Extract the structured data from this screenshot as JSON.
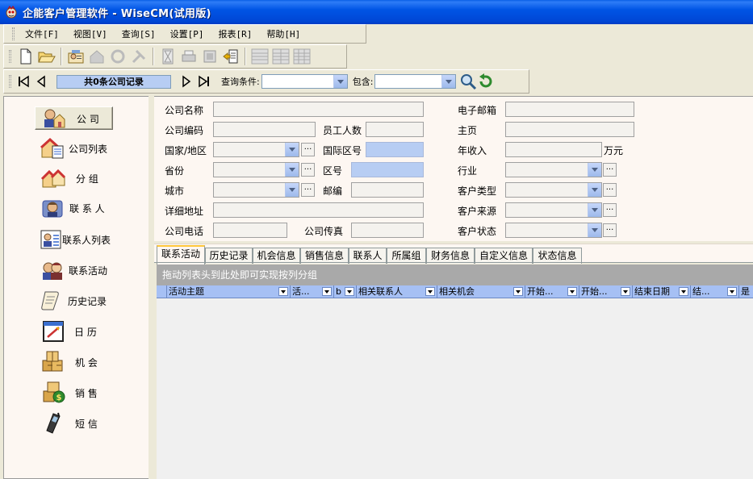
{
  "window": {
    "title": "企能客户管理软件 - WiseCM(试用版)"
  },
  "menu": [
    "文件[F]",
    "视图[V]",
    "查询[S]",
    "设置[P]",
    "报表[R]",
    "帮助[H]"
  ],
  "nav": {
    "record_label": "共0条公司记录",
    "query_label": "查询条件:",
    "contains_label": "包含:",
    "query_value": "",
    "contains_value": ""
  },
  "sidebar": {
    "items": [
      {
        "label": "公  司",
        "icon": "company-icon"
      },
      {
        "label": "公司列表",
        "icon": "company-list-icon"
      },
      {
        "label": "分  组",
        "icon": "group-icon"
      },
      {
        "label": "联 系 人",
        "icon": "contact-icon"
      },
      {
        "label": "联系人列表",
        "icon": "contact-list-icon"
      },
      {
        "label": "联系活动",
        "icon": "activity-icon"
      },
      {
        "label": "历史记录",
        "icon": "history-icon"
      },
      {
        "label": "日  历",
        "icon": "calendar-icon"
      },
      {
        "label": "机  会",
        "icon": "opportunity-icon"
      },
      {
        "label": "销  售",
        "icon": "sales-icon"
      },
      {
        "label": "短  信",
        "icon": "sms-icon"
      }
    ]
  },
  "form": {
    "company_name": "公司名称",
    "email": "电子邮箱",
    "company_code": "公司编码",
    "employees": "员工人数",
    "homepage": "主页",
    "country": "国家/地区",
    "intl_code": "国际区号",
    "annual_income": "年收入",
    "currency_unit": "万元",
    "province": "省份",
    "area_code": "区号",
    "industry": "行业",
    "city": "城市",
    "postcode": "邮编",
    "customer_type": "客户类型",
    "address": "详细地址",
    "customer_source": "客户来源",
    "phone": "公司电话",
    "fax": "公司传真",
    "customer_status": "客户状态"
  },
  "tabs": [
    "联系活动",
    "历史记录",
    "机会信息",
    "销售信息",
    "联系人",
    "所属组",
    "财务信息",
    "自定义信息",
    "状态信息"
  ],
  "grid": {
    "group_hint": "拖动列表头到此处即可实现按列分组",
    "columns": [
      "活动主题",
      "活...",
      "b",
      "相关联系人",
      "相关机会",
      "开始...",
      "开始...",
      "结束日期",
      "结...",
      "是"
    ]
  },
  "colors": {
    "title_blue": "#0055E5",
    "header_blue": "#A6C0F4",
    "record_blue": "#B7CDF3",
    "form_bg": "#FDF7F2",
    "group_gray": "#A9A9A9"
  }
}
